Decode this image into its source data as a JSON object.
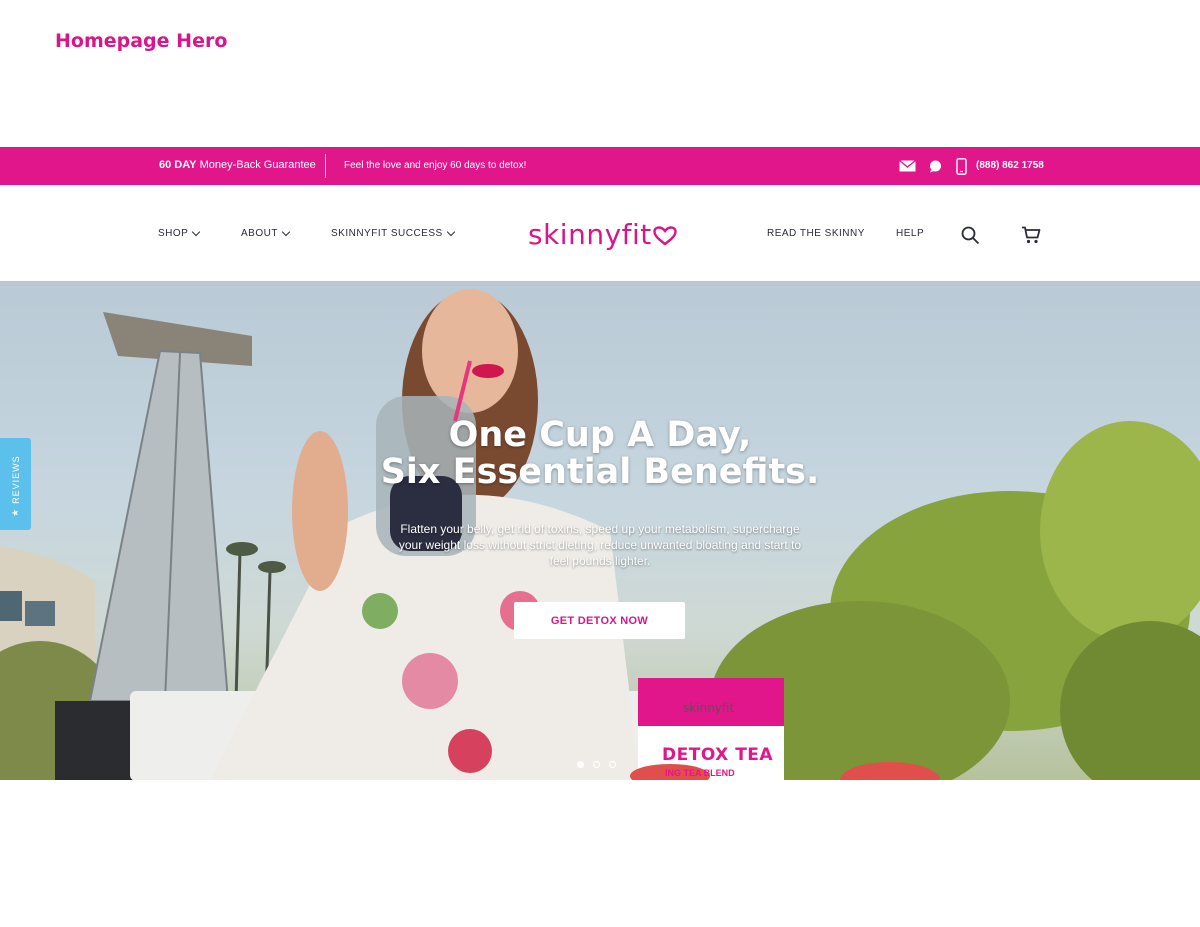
{
  "page_label": "Homepage Hero",
  "topbar": {
    "guarantee_bold": "60 DAY",
    "guarantee_text": " Money-Back Guarantee",
    "tagline": "Feel the love and enjoy 60 days to detox!",
    "phone": "(888) 862 1758",
    "icons": [
      "mail-icon",
      "chat-icon",
      "phone-icon"
    ]
  },
  "nav": {
    "shop": "SHOP",
    "about": "ABOUT",
    "success": "SKINNYFIT SUCCESS",
    "logo_a": "skinny",
    "logo_b": "fit",
    "read": "READ THE SKINNY",
    "help": "HELP",
    "icons": [
      "search-icon",
      "cart-icon"
    ]
  },
  "hero": {
    "title_line1": "One Cup A Day,",
    "title_line2": "Six Essential Benefits.",
    "subtitle": "Flatten your belly, get rid of toxins, speed up your metabolism, supercharge your weight loss without strict dieting, reduce unwanted bloating and start to feel pounds lighter.",
    "cta": "GET DETOX NOW",
    "slides": 3,
    "active_slide": 1,
    "package_brand": "skinnyfit",
    "package_name": "DETOX TEA",
    "package_sub": "ING TEA BLEND"
  },
  "reviews_tab": {
    "label": "REVIEWS"
  },
  "colors": {
    "brand_pink": "#e2168b",
    "reviews_blue": "#5bc0eb"
  }
}
